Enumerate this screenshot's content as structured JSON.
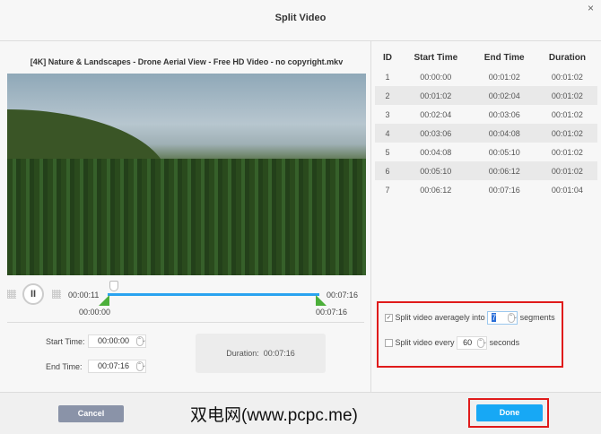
{
  "title": "Split Video",
  "close_icon": "×",
  "file_name": "[4K] Nature & Landscapes - Drone Aerial View - Free HD Video - no copyright.mkv",
  "player": {
    "pause_label": "II",
    "current_time": "00:00:11",
    "total_time": "00:07:16",
    "range_start": "00:00:00",
    "range_end": "00:07:16",
    "progress_fraction": 0.025
  },
  "trim": {
    "start_label": "Start Time:",
    "start_value": "00:00:00",
    "end_label": "End Time:",
    "end_value": "00:07:16",
    "duration_label": "Duration:",
    "duration_value": "00:07:16"
  },
  "table": {
    "headers": [
      "ID",
      "Start Time",
      "End Time",
      "Duration"
    ],
    "rows": [
      [
        "1",
        "00:00:00",
        "00:01:02",
        "00:01:02"
      ],
      [
        "2",
        "00:01:02",
        "00:02:04",
        "00:01:02"
      ],
      [
        "3",
        "00:02:04",
        "00:03:06",
        "00:01:02"
      ],
      [
        "4",
        "00:03:06",
        "00:04:08",
        "00:01:02"
      ],
      [
        "5",
        "00:04:08",
        "00:05:10",
        "00:01:02"
      ],
      [
        "6",
        "00:05:10",
        "00:06:12",
        "00:01:02"
      ],
      [
        "7",
        "00:06:12",
        "00:07:16",
        "00:01:04"
      ]
    ]
  },
  "options": {
    "avg_label": "Split video averagely into",
    "avg_value": "7",
    "avg_unit": "segments",
    "avg_checked": true,
    "every_label": "Split video every",
    "every_value": "60",
    "every_unit": "seconds",
    "every_checked": false
  },
  "footer": {
    "cancel": "Cancel",
    "done": "Done",
    "watermark": "双电网(www.pcpc.me)"
  },
  "colors": {
    "accent": "#2aa3f0",
    "done": "#17a8f5",
    "cancel": "#8a93a8",
    "highlight": "#e01b1b"
  }
}
